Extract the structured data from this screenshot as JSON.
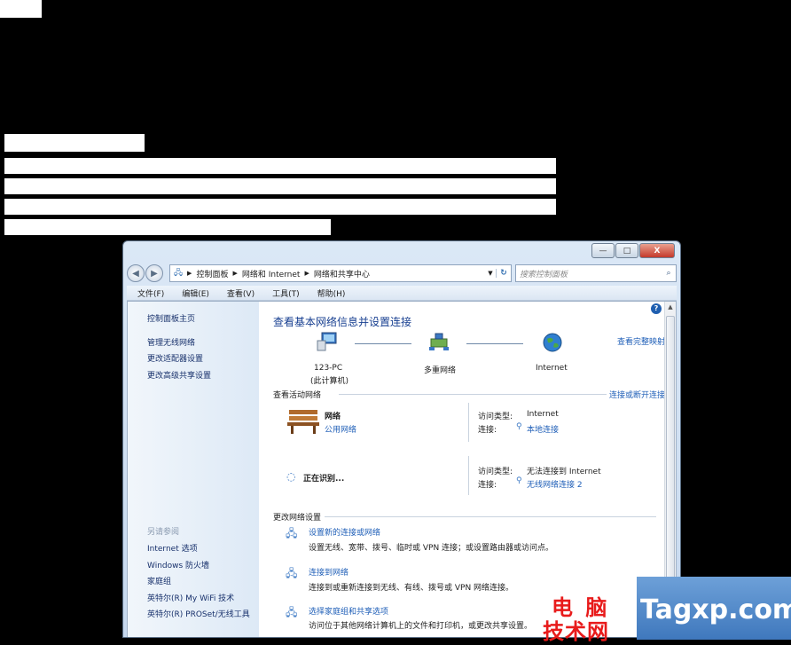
{
  "window": {
    "caption_buttons": {
      "minimize": "—",
      "maximize": "□",
      "close": "X"
    }
  },
  "nav": {
    "back": "◀",
    "forward": "▶",
    "breadcrumb": [
      "控制面板",
      "网络和 Internet",
      "网络和共享中心"
    ],
    "search_placeholder": "搜索控制面板"
  },
  "menu": {
    "items": [
      "文件(F)",
      "编辑(E)",
      "查看(V)",
      "工具(T)",
      "帮助(H)"
    ]
  },
  "sidebar": {
    "home": "控制面板主页",
    "items": [
      "管理无线网络",
      "更改适配器设置",
      "更改高级共享设置"
    ],
    "see_also_heading": "另请参阅",
    "see_also": [
      "Internet 选项",
      "Windows 防火墙",
      "家庭组",
      "英特尔(R) My WiFi 技术",
      "英特尔(R) PROSet/无线工具"
    ]
  },
  "main": {
    "title": "查看基本网络信息并设置连接",
    "view_full_map": "查看完整映射",
    "nodes": [
      {
        "label": "123-PC",
        "sub": "(此计算机)"
      },
      {
        "label": "多重网络",
        "sub": ""
      },
      {
        "label": "Internet",
        "sub": ""
      }
    ],
    "active_heading": "查看活动网络",
    "connect_disconnect": "连接或断开连接",
    "networks": [
      {
        "name": "网络",
        "type_link": "公用网络",
        "access_label": "访问类型:",
        "access_value": "Internet",
        "conn_label": "连接:",
        "conn_value": "本地连接"
      },
      {
        "name": "正在识别...",
        "access_label": "访问类型:",
        "access_value": "无法连接到 Internet",
        "conn_label": "连接:",
        "conn_value": "无线网络连接 2"
      }
    ],
    "change_heading": "更改网络设置",
    "tasks": [
      {
        "title": "设置新的连接或网络",
        "desc": "设置无线、宽带、拨号、临时或 VPN 连接；或设置路由器或访问点。"
      },
      {
        "title": "连接到网络",
        "desc": "连接到或重新连接到无线、有线、拨号或 VPN 网络连接。"
      },
      {
        "title": "选择家庭组和共享选项",
        "desc": "访问位于其他网络计算机上的文件和打印机，或更改共享设置。"
      }
    ]
  },
  "watermark": {
    "line1": "电 脑",
    "line2": "技术网",
    "site": "Tagxp.com"
  }
}
